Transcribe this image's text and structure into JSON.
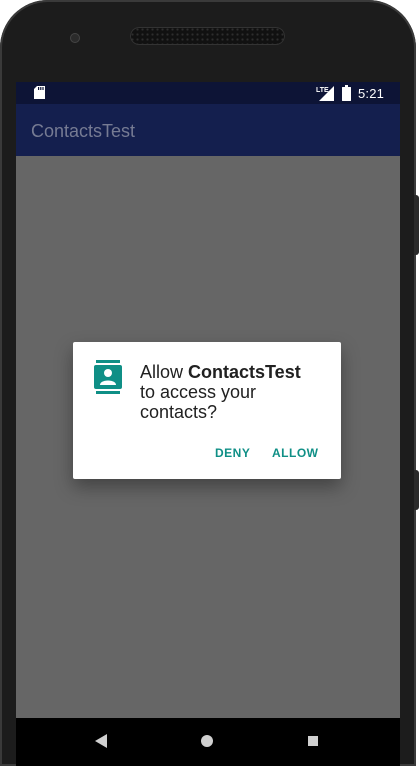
{
  "status_bar": {
    "time": "5:21",
    "network_label": "LTE",
    "icons": [
      "sd-card-icon",
      "lte-signal-icon",
      "battery-icon"
    ]
  },
  "app_bar": {
    "title": "ContactsTest"
  },
  "permission_dialog": {
    "prefix": "Allow ",
    "app_name": "ContactsTest",
    "suffix": "to access your contacts?",
    "icon": "contacts-icon",
    "deny_label": "DENY",
    "allow_label": "ALLOW",
    "accent_color": "#0f8f86"
  },
  "nav_bar": {
    "buttons": [
      "back-icon",
      "home-icon",
      "recents-icon"
    ]
  },
  "colors": {
    "status_bar": "#0d1436",
    "app_bar": "#141f4e",
    "scrim": "#666666"
  }
}
